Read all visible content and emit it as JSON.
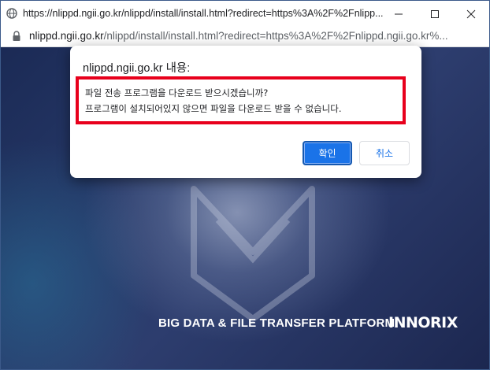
{
  "window": {
    "title": "https://nlippd.ngii.go.kr/nlippd/install/install.html?redirect=https%3A%2F%2Fnlipp...",
    "icons": {
      "site": "globe-icon",
      "minimize": "minimize-icon",
      "maximize": "maximize-icon",
      "close": "close-icon"
    }
  },
  "address": {
    "host": "nlippd.ngii.go.kr",
    "path": "/nlippd/install/install.html?redirect=https%3A%2F%2Fnlippd.ngii.go.kr%..."
  },
  "dialog": {
    "origin": "nlippd.ngii.go.kr 내용:",
    "message_line1": "파일 전송 프로그램을 다운로드 받으시겠습니까?",
    "message_line2": "프로그램이 설치되어있지 않으면 파일을 다운로드 받을 수 없습니다.",
    "ok_label": "확인",
    "cancel_label": "취소",
    "highlight_color": "#e8001c",
    "accent_color": "#1a73e8"
  },
  "page": {
    "tagline": "BIG DATA & FILE TRANSFER PLATFORM",
    "brand": "INNORIX"
  }
}
